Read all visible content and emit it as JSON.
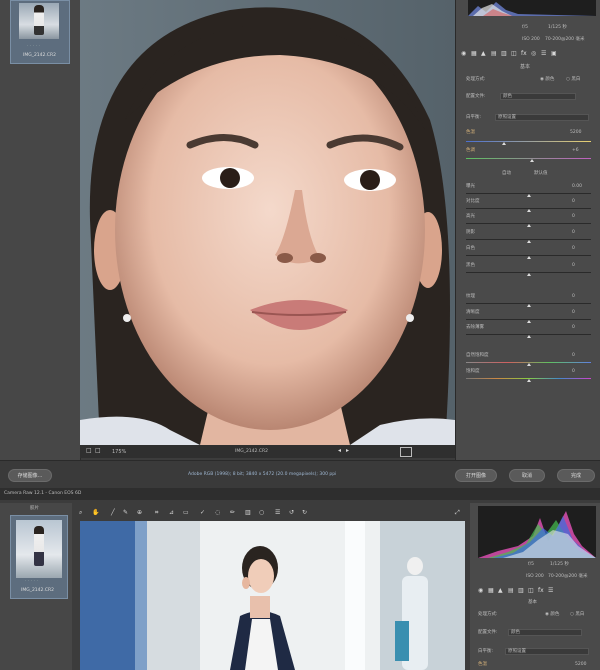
{
  "top": {
    "filename": "IMG_2142.CR2",
    "zoom": "175%",
    "footer_info": "Adobe RGB (1998); 8 bit; 3840 x 5472 (20.0 megapixels); 300 ppi",
    "buttons": {
      "save_image": "存储图像...",
      "open_image": "打开图像",
      "cancel": "取消",
      "done": "完成"
    },
    "histogram_info": {
      "aperture": "f/5",
      "shutter": "1/125 秒",
      "iso": "ISO 200",
      "lens": "70-200@200 毫米"
    },
    "panel_title": "基本",
    "treatment_label": "处理方式:",
    "treatment_options": [
      "颜色",
      "黑白"
    ],
    "profile_label": "配置文件:",
    "profile_value": "颜色",
    "wb_label": "白平衡:",
    "wb_value": "原照设置",
    "temp_label": "色温",
    "temp_value": "5200",
    "tint_label": "色调",
    "tint_value": "+6",
    "auto": "自动",
    "default": "默认值",
    "sliders": [
      {
        "label": "曝光",
        "value": "0.00"
      },
      {
        "label": "对比度",
        "value": "0"
      },
      {
        "label": "高光",
        "value": "0"
      },
      {
        "label": "阴影",
        "value": "0"
      },
      {
        "label": "白色",
        "value": "0"
      },
      {
        "label": "黑色",
        "value": "0"
      },
      {
        "label": "纹理",
        "value": "0"
      },
      {
        "label": "清晰度",
        "value": "0"
      },
      {
        "label": "去除薄雾",
        "value": "0"
      },
      {
        "label": "自然饱和度",
        "value": "0"
      },
      {
        "label": "饱和度",
        "value": "0"
      }
    ]
  },
  "bottom": {
    "title": "Camera Raw 12.1 - Canon EOS 6D",
    "filmstrip_label": "胶片",
    "filename": "IMG_2142.CR2",
    "histogram_info": {
      "aperture": "f/5",
      "shutter": "1/125 秒",
      "iso": "ISO 200",
      "lens": "70-200@200 毫米"
    },
    "panel_title": "基本",
    "treatment_label": "处理方式:",
    "treatment_options": [
      "颜色",
      "黑白"
    ],
    "profile_label": "配置文件:",
    "profile_value": "颜色",
    "wb_label": "白平衡:",
    "wb_value": "原照设置",
    "temp_label": "色温",
    "temp_value": "5200"
  }
}
